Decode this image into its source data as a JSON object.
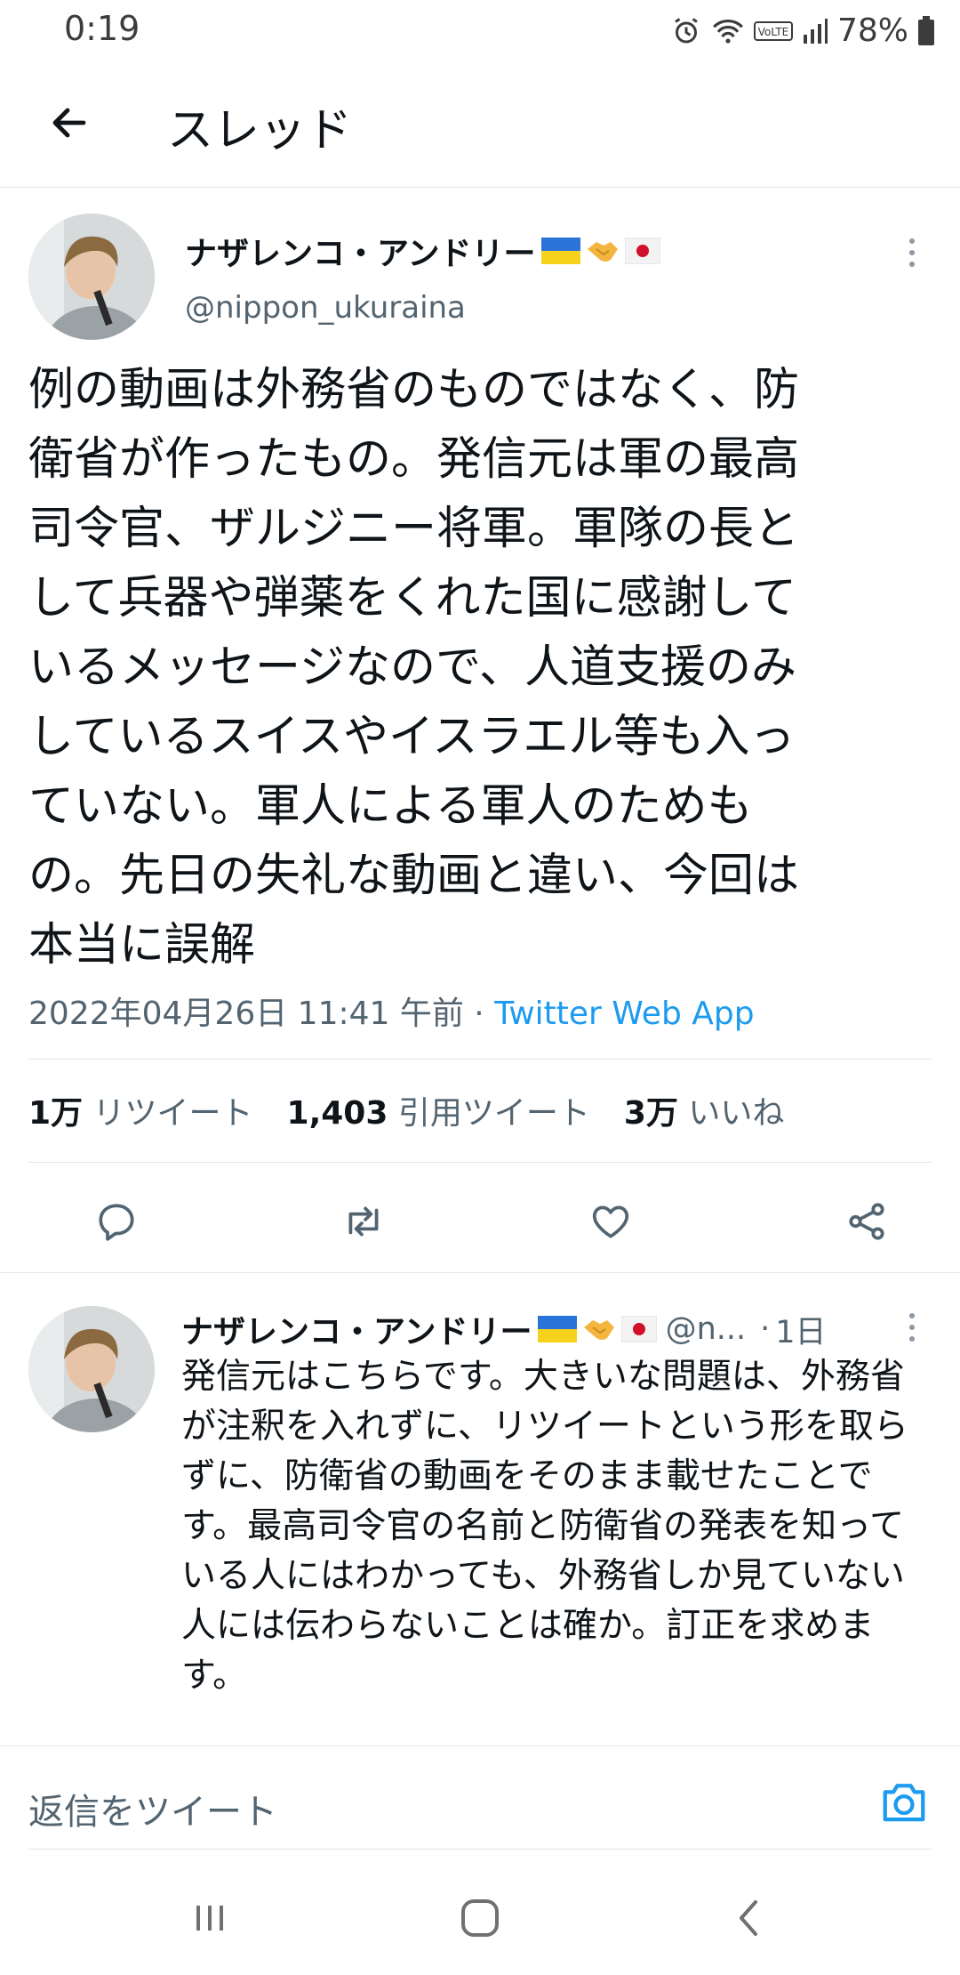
{
  "status_bar": {
    "time": "0:19",
    "battery": "78%",
    "icons": [
      "alarm-icon",
      "wifi-icon",
      "volte-icon",
      "signal-icon",
      "battery-icon"
    ]
  },
  "header": {
    "title": "スレッド",
    "back_icon": "arrow-left-icon"
  },
  "main_tweet": {
    "author_name": "ナザレンコ・アンドリー",
    "author_emojis": [
      "ukraine-flag",
      "handshake",
      "japan-flag"
    ],
    "handle": "@nippon_ukuraina",
    "text": "例の動画は外務省のものではなく、防\n衛省が作ったもの。発信元は軍の最高\n司令官、ザルジニー将軍。軍隊の長と\nして兵器や弾薬をくれた国に感謝して\nいるメッセージなので、人道支援のみ\nしているスイスやイスラエル等も入っ\nていない。軍人による軍人のためも\nの。先日の失礼な動画と違い、今回は\n本当に誤解",
    "timestamp": "2022年04月26日 11:41 午前 · ",
    "via": "Twitter Web App",
    "stats": {
      "retweets_count": "1万",
      "retweets_label": "リツイート",
      "quotes_count": "1,403",
      "quotes_label": "引用ツイート",
      "likes_count": "3万",
      "likes_label": "いいね"
    },
    "actions": [
      "reply-icon",
      "retweet-icon",
      "like-icon",
      "share-icon"
    ]
  },
  "reply_tweet": {
    "author_name": "ナザレンコ・アンドリー",
    "handle_truncated": "@n...",
    "separator": "·",
    "age": "1日",
    "text": "発信元はこちらです。大きいな問題は、外務省\nが注釈を入れずに、リツイートという形を取ら\nずに、防衛省の動画をそのまま載せたことで\nす。最高司令官の名前と防衛省の発表を知って\nいる人にはわかっても、外務省しか見ていない\n人には伝わらないことは確か。訂正を求めま\nす。"
  },
  "reply_bar": {
    "placeholder": "返信をツイート",
    "camera_icon": "camera-icon"
  },
  "nav_bar": {
    "buttons": [
      "recent-apps-icon",
      "home-icon",
      "back-icon"
    ]
  },
  "colors": {
    "accent": "#1d9bf0",
    "text": "#0f1419",
    "secondary": "#536471",
    "divider": "#e6e6e6"
  }
}
